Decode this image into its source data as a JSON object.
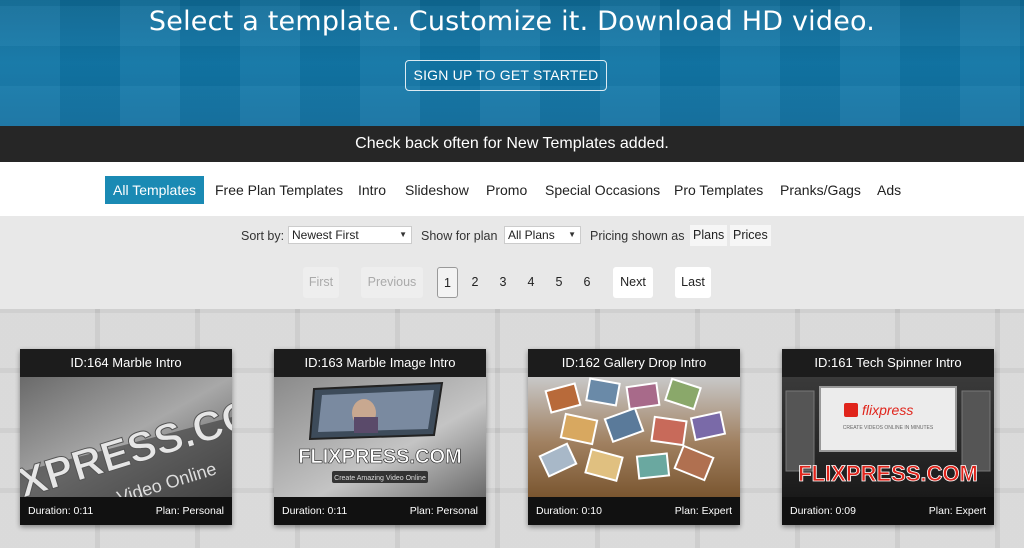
{
  "hero": {
    "title": "Select a template. Customize it. Download HD video.",
    "cta": "SIGN UP TO GET STARTED"
  },
  "notice": "Check back often for New Templates added.",
  "categories": [
    {
      "label": "All Templates",
      "active": true
    },
    {
      "label": "Free Plan Templates"
    },
    {
      "label": "Intro"
    },
    {
      "label": "Slideshow"
    },
    {
      "label": "Promo"
    },
    {
      "label": "Special Occasions"
    },
    {
      "label": "Pro Templates"
    },
    {
      "label": "Pranks/Gags"
    },
    {
      "label": "Ads"
    }
  ],
  "controls": {
    "sort_label": "Sort by:",
    "sort_value": "Newest First",
    "plan_label": "Show for plan",
    "plan_value": "All Plans",
    "pricing_label": "Pricing shown as",
    "pricing_options": [
      "Plans",
      "Prices"
    ]
  },
  "pagination": {
    "first": "First",
    "previous": "Previous",
    "pages": [
      "1",
      "2",
      "3",
      "4",
      "5",
      "6"
    ],
    "current": "1",
    "next": "Next",
    "last": "Last"
  },
  "templates": [
    {
      "title": "ID:164 Marble Intro",
      "duration": "Duration: 0:11",
      "plan": "Plan: Personal",
      "thumb_text": [
        "XPRESS.COM",
        "Video Online"
      ]
    },
    {
      "title": "ID:163 Marble Image Intro",
      "duration": "Duration: 0:11",
      "plan": "Plan: Personal",
      "thumb_text": [
        "FLIXPRESS.COM",
        "Create Amazing Video Online"
      ]
    },
    {
      "title": "ID:162 Gallery Drop Intro",
      "duration": "Duration: 0:10",
      "plan": "Plan: Expert",
      "thumb_text": []
    },
    {
      "title": "ID:161 Tech Spinner Intro",
      "duration": "Duration: 0:09",
      "plan": "Plan: Expert",
      "thumb_text": [
        "flixpress",
        "CREATE VIDEOS ONLINE IN MINUTES",
        "FLIXPRESS.COM"
      ]
    }
  ],
  "colors": {
    "hero_bg": "#127aab",
    "notice_bg": "#262626",
    "active_tab": "#1a8ab4",
    "controls_bg": "#e8e8e8",
    "card_bg": "#111111",
    "flixpress_red": "#e0241b"
  }
}
